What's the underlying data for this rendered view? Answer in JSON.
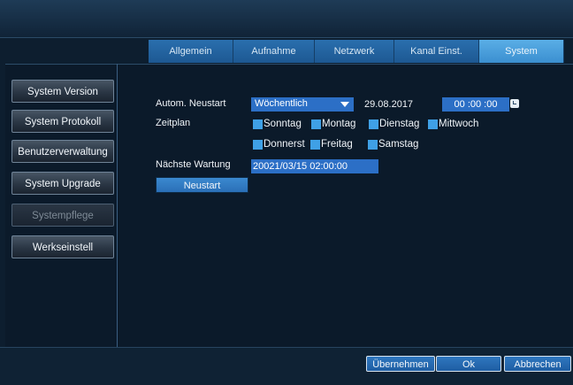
{
  "tabs": {
    "items": [
      "Allgemein",
      "Aufnahme",
      "Netzwerk",
      "Kanal Einst.",
      "System"
    ],
    "active": "System"
  },
  "sidebar": {
    "items": [
      "System Version",
      "System Protokoll",
      "Benutzerverwaltung",
      "System Upgrade",
      "Systempflege",
      "Werkseinstell"
    ],
    "active": "Systempflege"
  },
  "form": {
    "auto_restart_label": "Autom. Neustart",
    "auto_restart_value": "Wöchentlich",
    "date": "29.08.2017",
    "time": "00 :00 :00",
    "schedule_label": "Zeitplan",
    "days": [
      "Sonntag",
      "Montag",
      "Dienstag",
      "Mittwoch",
      "Donnerst",
      "Freitag",
      "Samstag"
    ],
    "next_maintenance_label": "Nächste Wartung",
    "next_maintenance_value": "20021/03/15  02:00:00",
    "restart_button": "Neustart"
  },
  "footer": {
    "apply": "Übernehmen",
    "ok": "Ok",
    "cancel": "Abbrechen"
  },
  "colors": {
    "accent": "#3b8fd0",
    "field": "#2c6fc6",
    "checkbox": "#3fa0e6"
  }
}
